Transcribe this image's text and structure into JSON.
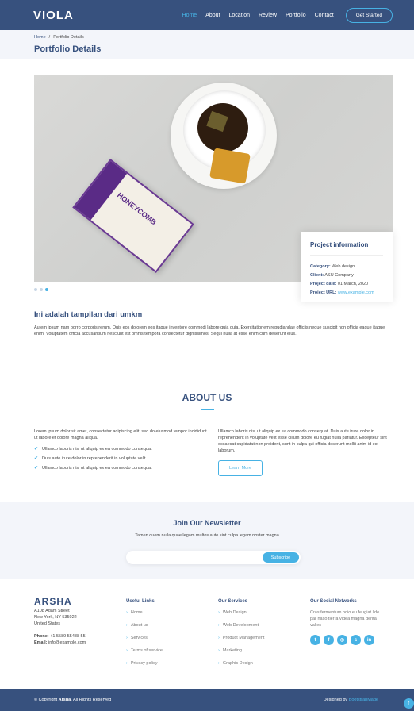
{
  "header": {
    "logo": "VIOLA",
    "nav": [
      "Home",
      "About",
      "Location",
      "Review",
      "Portfolio",
      "Contact"
    ],
    "cta": "Get Started",
    "colors": {
      "bar": "#37517e",
      "accent": "#47b2e4"
    }
  },
  "breadcrumb": {
    "home": "Home",
    "sep": "/",
    "current": "Portfolio Details"
  },
  "page_title": "Portfolio Details",
  "hero": {
    "package_text": "HONEYCOMB"
  },
  "project": {
    "heading": "Project information",
    "category_label": "Category:",
    "category": "Web design",
    "client_label": "Client:",
    "client": "ASU Company",
    "date_label": "Project date:",
    "date": "01 March, 2020",
    "url_label": "Project URL:",
    "url": "www.example.com"
  },
  "description": {
    "title": "Ini adalah tampilan dari umkm",
    "text": "Autem ipsum nam porro corporis rerum. Quis eos dolorem eos itaque inventore commodi labore quia quia. Exercitationem repudiandae officiis neque suscipit non officia eaque itaque enim. Voluptatem officia accusantium nesciunt est omnis tempora consectetur dignissimos. Sequi nulla at esse enim cum deserunt eius."
  },
  "about": {
    "title": "ABOUT US",
    "intro": "Lorem ipsum dolor sit amet, consectetur adipiscing elit, sed do eiusmod tempor incididunt ut labore et dolore magna aliqua.",
    "items": [
      "Ullamco laboris nisi ut aliquip ex ea commodo consequat",
      "Duis aute irure dolor in reprehenderit in voluptate velit",
      "Ullamco laboris nisi ut aliquip ex ea commodo consequat"
    ],
    "right_text": "Ullamco laboris nisi ut aliquip ex ea commodo consequat. Duis aute irure dolor in reprehenderit in voluptate velit esse cillum dolore eu fugiat nulla pariatur. Excepteur sint occaecat cupidatat non proident, sunt in culpa qui officia deserunt mollit anim id est laborum.",
    "button": "Learn More"
  },
  "newsletter": {
    "title": "Join Our Newsletter",
    "text": "Tamen quem nulla quae legam multos aute sint culpa legam noster magna",
    "button": "Subscribe",
    "placeholder": ""
  },
  "footer": {
    "brand": "ARSHA",
    "address": [
      "A108 Adam Street",
      "New York, NY 535022",
      "United States"
    ],
    "phone_label": "Phone:",
    "phone": "+1 5589 55488 55",
    "email_label": "Email:",
    "email": "info@example.com",
    "links_title": "Useful Links",
    "links": [
      "Home",
      "About us",
      "Services",
      "Terms of service",
      "Privacy policy"
    ],
    "services_title": "Our Services",
    "services": [
      "Web Design",
      "Web Development",
      "Product Management",
      "Marketing",
      "Graphic Design"
    ],
    "social_title": "Our Social Networks",
    "social_text": "Cras fermentum odio eu feugiat lide par naso tierra videa magna derita valies",
    "social_icons": [
      "twitter-icon",
      "facebook-icon",
      "instagram-icon",
      "skype-icon",
      "linkedin-icon"
    ]
  },
  "bottom": {
    "copyright_pre": "© Copyright",
    "copyright_brand": "Arsha",
    "copyright_post": ". All Rights Reserved",
    "designed_by": "Designed by",
    "designer": "BootstrapMade"
  }
}
